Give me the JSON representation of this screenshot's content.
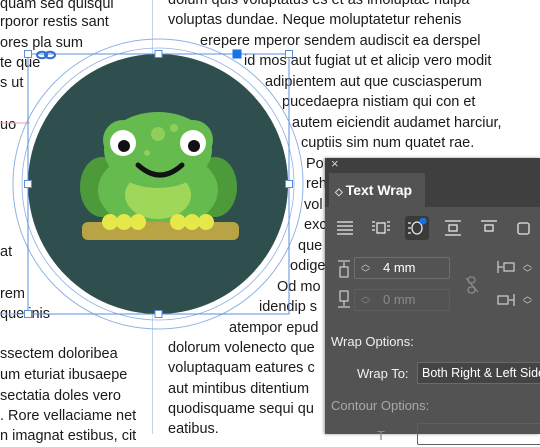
{
  "document": {
    "left_column": [
      "quam sed quisqui",
      "rporor restis sant",
      "ores pla sum",
      "te que",
      "s ut",
      "uo",
      "at",
      "rem",
      "que inis",
      "ssectem doloribea",
      "um eturiat ibusaepe",
      "sectatia doles vero",
      ". Rore vellaciame net",
      "n imagnat estibus, cit"
    ],
    "right_column": [
      "dolum quis voluptatus es et as imoluptae nulpa",
      "voluptas dundae. Neque moluptatetur rehenis",
      "erepere mperor sendem audiscit ea derspel",
      "id mos aut fugiat ut et alicip vero modit",
      "adipientem aut que cusciasperum",
      "pucedaepra nistiam qui con et",
      "autem eiciendit audamet harciur,",
      "cuptiis sim num quatet rae.",
      "Po",
      "reh",
      "vol",
      "exc",
      "que",
      "odige",
      "Od mo",
      "idendip s",
      "atempor epud",
      "dolorum volenecto que",
      "voluptaquam eatures c",
      "aut mintibus ditentium",
      "quodisquame sequi qu",
      "eatibus."
    ]
  },
  "panel": {
    "close_glyph": "×",
    "title": "Text Wrap",
    "top_offset": "4 mm",
    "bottom_offset": "0 mm",
    "wrap_options_label": "Wrap Options:",
    "wrap_to_label": "Wrap To:",
    "wrap_to_value": "Both Right & Left Sides",
    "contour_options_label": "Contour Options:",
    "selected_mode": "wrap-around-object-shape"
  },
  "colors": {
    "circle": "#2f4f4f",
    "frog_body": "#66bb4f",
    "frog_light": "#9fd75a",
    "log": "#b9a445",
    "panel_bg": "#535353",
    "accent": "#1473e6"
  }
}
